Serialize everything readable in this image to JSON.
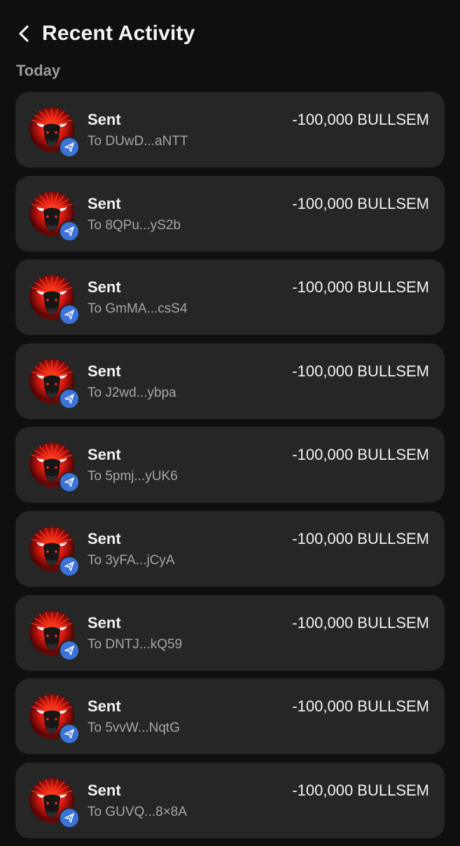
{
  "header": {
    "title": "Recent Activity",
    "back_icon": "chevron-left-icon"
  },
  "section": {
    "label": "Today"
  },
  "colors": {
    "background": "#0f0f0f",
    "card": "#262626",
    "badge": "#3b73d9",
    "secondary_text": "#a6a6a6",
    "avatar_accent": "#e02b1a"
  },
  "transactions": [
    {
      "type": "Sent",
      "address": "To DUwD...aNTT",
      "amount": "-100,000 BULLSEM",
      "avatar_icon": "bull-token-icon",
      "badge_icon": "paper-plane-icon"
    },
    {
      "type": "Sent",
      "address": "To 8QPu...yS2b",
      "amount": "-100,000 BULLSEM",
      "avatar_icon": "bull-token-icon",
      "badge_icon": "paper-plane-icon"
    },
    {
      "type": "Sent",
      "address": "To GmMA...csS4",
      "amount": "-100,000 BULLSEM",
      "avatar_icon": "bull-token-icon",
      "badge_icon": "paper-plane-icon"
    },
    {
      "type": "Sent",
      "address": "To J2wd...ybpa",
      "amount": "-100,000 BULLSEM",
      "avatar_icon": "bull-token-icon",
      "badge_icon": "paper-plane-icon"
    },
    {
      "type": "Sent",
      "address": "To 5pmj...yUK6",
      "amount": "-100,000 BULLSEM",
      "avatar_icon": "bull-token-icon",
      "badge_icon": "paper-plane-icon"
    },
    {
      "type": "Sent",
      "address": "To 3yFA...jCyA",
      "amount": "-100,000 BULLSEM",
      "avatar_icon": "bull-token-icon",
      "badge_icon": "paper-plane-icon"
    },
    {
      "type": "Sent",
      "address": "To DNTJ...kQ59",
      "amount": "-100,000 BULLSEM",
      "avatar_icon": "bull-token-icon",
      "badge_icon": "paper-plane-icon"
    },
    {
      "type": "Sent",
      "address": "To 5vvW...NqtG",
      "amount": "-100,000 BULLSEM",
      "avatar_icon": "bull-token-icon",
      "badge_icon": "paper-plane-icon"
    },
    {
      "type": "Sent",
      "address": "To GUVQ...8×8A",
      "amount": "-100,000 BULLSEM",
      "avatar_icon": "bull-token-icon",
      "badge_icon": "paper-plane-icon"
    }
  ]
}
